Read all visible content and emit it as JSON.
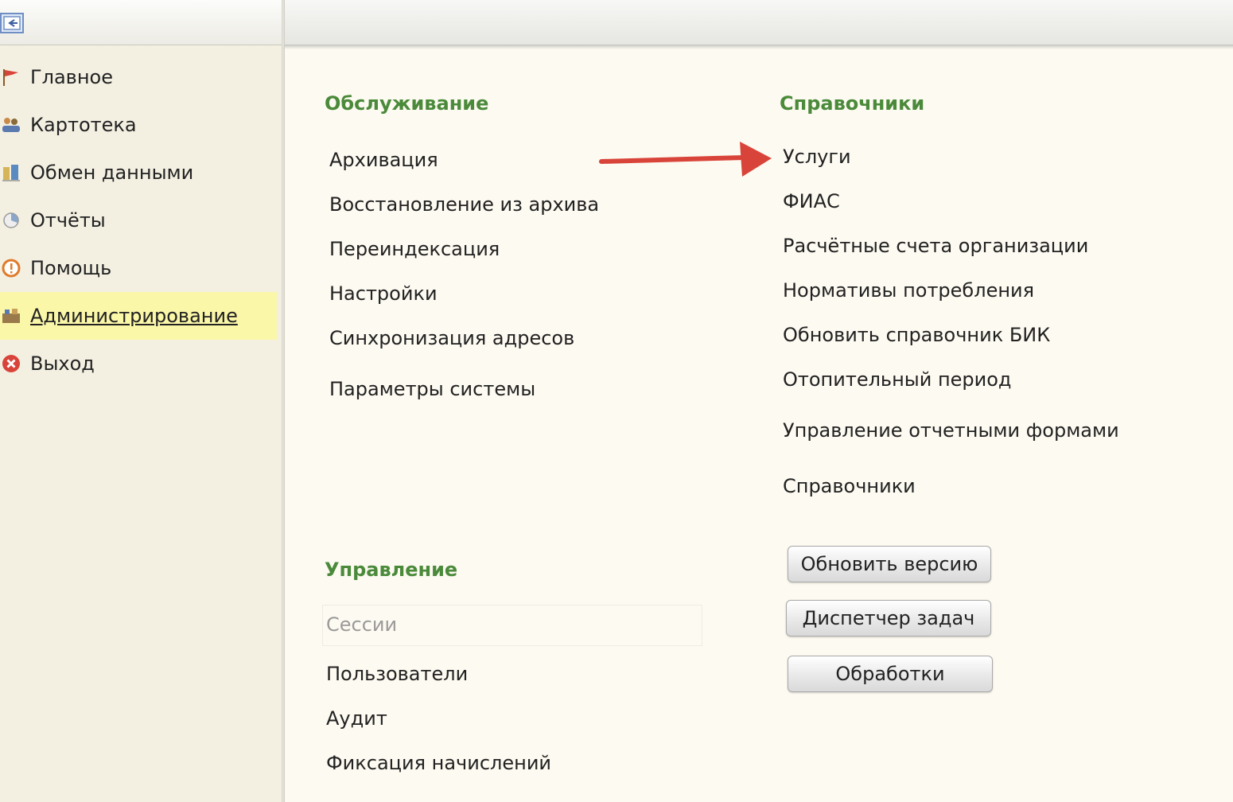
{
  "toolbar": {
    "back_icon": "back-arrow-icon"
  },
  "sidebar": {
    "items": [
      {
        "label": "Главное",
        "icon": "flag-icon",
        "active": false
      },
      {
        "label": "Картотека",
        "icon": "people-icon",
        "active": false
      },
      {
        "label": "Обмен данными",
        "icon": "exchange-icon",
        "active": false
      },
      {
        "label": "Отчёты",
        "icon": "reports-icon",
        "active": false
      },
      {
        "label": "Помощь",
        "icon": "help-icon",
        "active": false
      },
      {
        "label": "Администрирование",
        "icon": "admin-icon",
        "active": true
      },
      {
        "label": "Выход",
        "icon": "exit-icon",
        "active": false
      }
    ],
    "active_color": "#fbf7a9"
  },
  "maintenance": {
    "title": "Обслуживание",
    "links": [
      "Архивация",
      "Восстановление из архива",
      "Переиндексация",
      "Настройки",
      "Синхронизация адресов",
      "Параметры системы"
    ]
  },
  "references": {
    "title": "Справочники",
    "links": [
      "Услуги",
      "ФИАС",
      "Расчётные счета организации",
      "Нормативы потребления",
      "Обновить справочник БИК",
      "Отопительный период",
      "Управление отчетными формами",
      "Справочники"
    ]
  },
  "management": {
    "title": "Управление",
    "sessions_label": "Сессии",
    "links": [
      "Пользователи",
      "Аудит",
      "Фиксация начислений"
    ]
  },
  "buttons": {
    "update_version": "Обновить версию",
    "task_manager": "Диспетчер задач",
    "processing": "Обработки"
  },
  "colors": {
    "section_title": "#4a8a3a",
    "arrow": "#d9443a",
    "background": "#fdfaf1"
  }
}
